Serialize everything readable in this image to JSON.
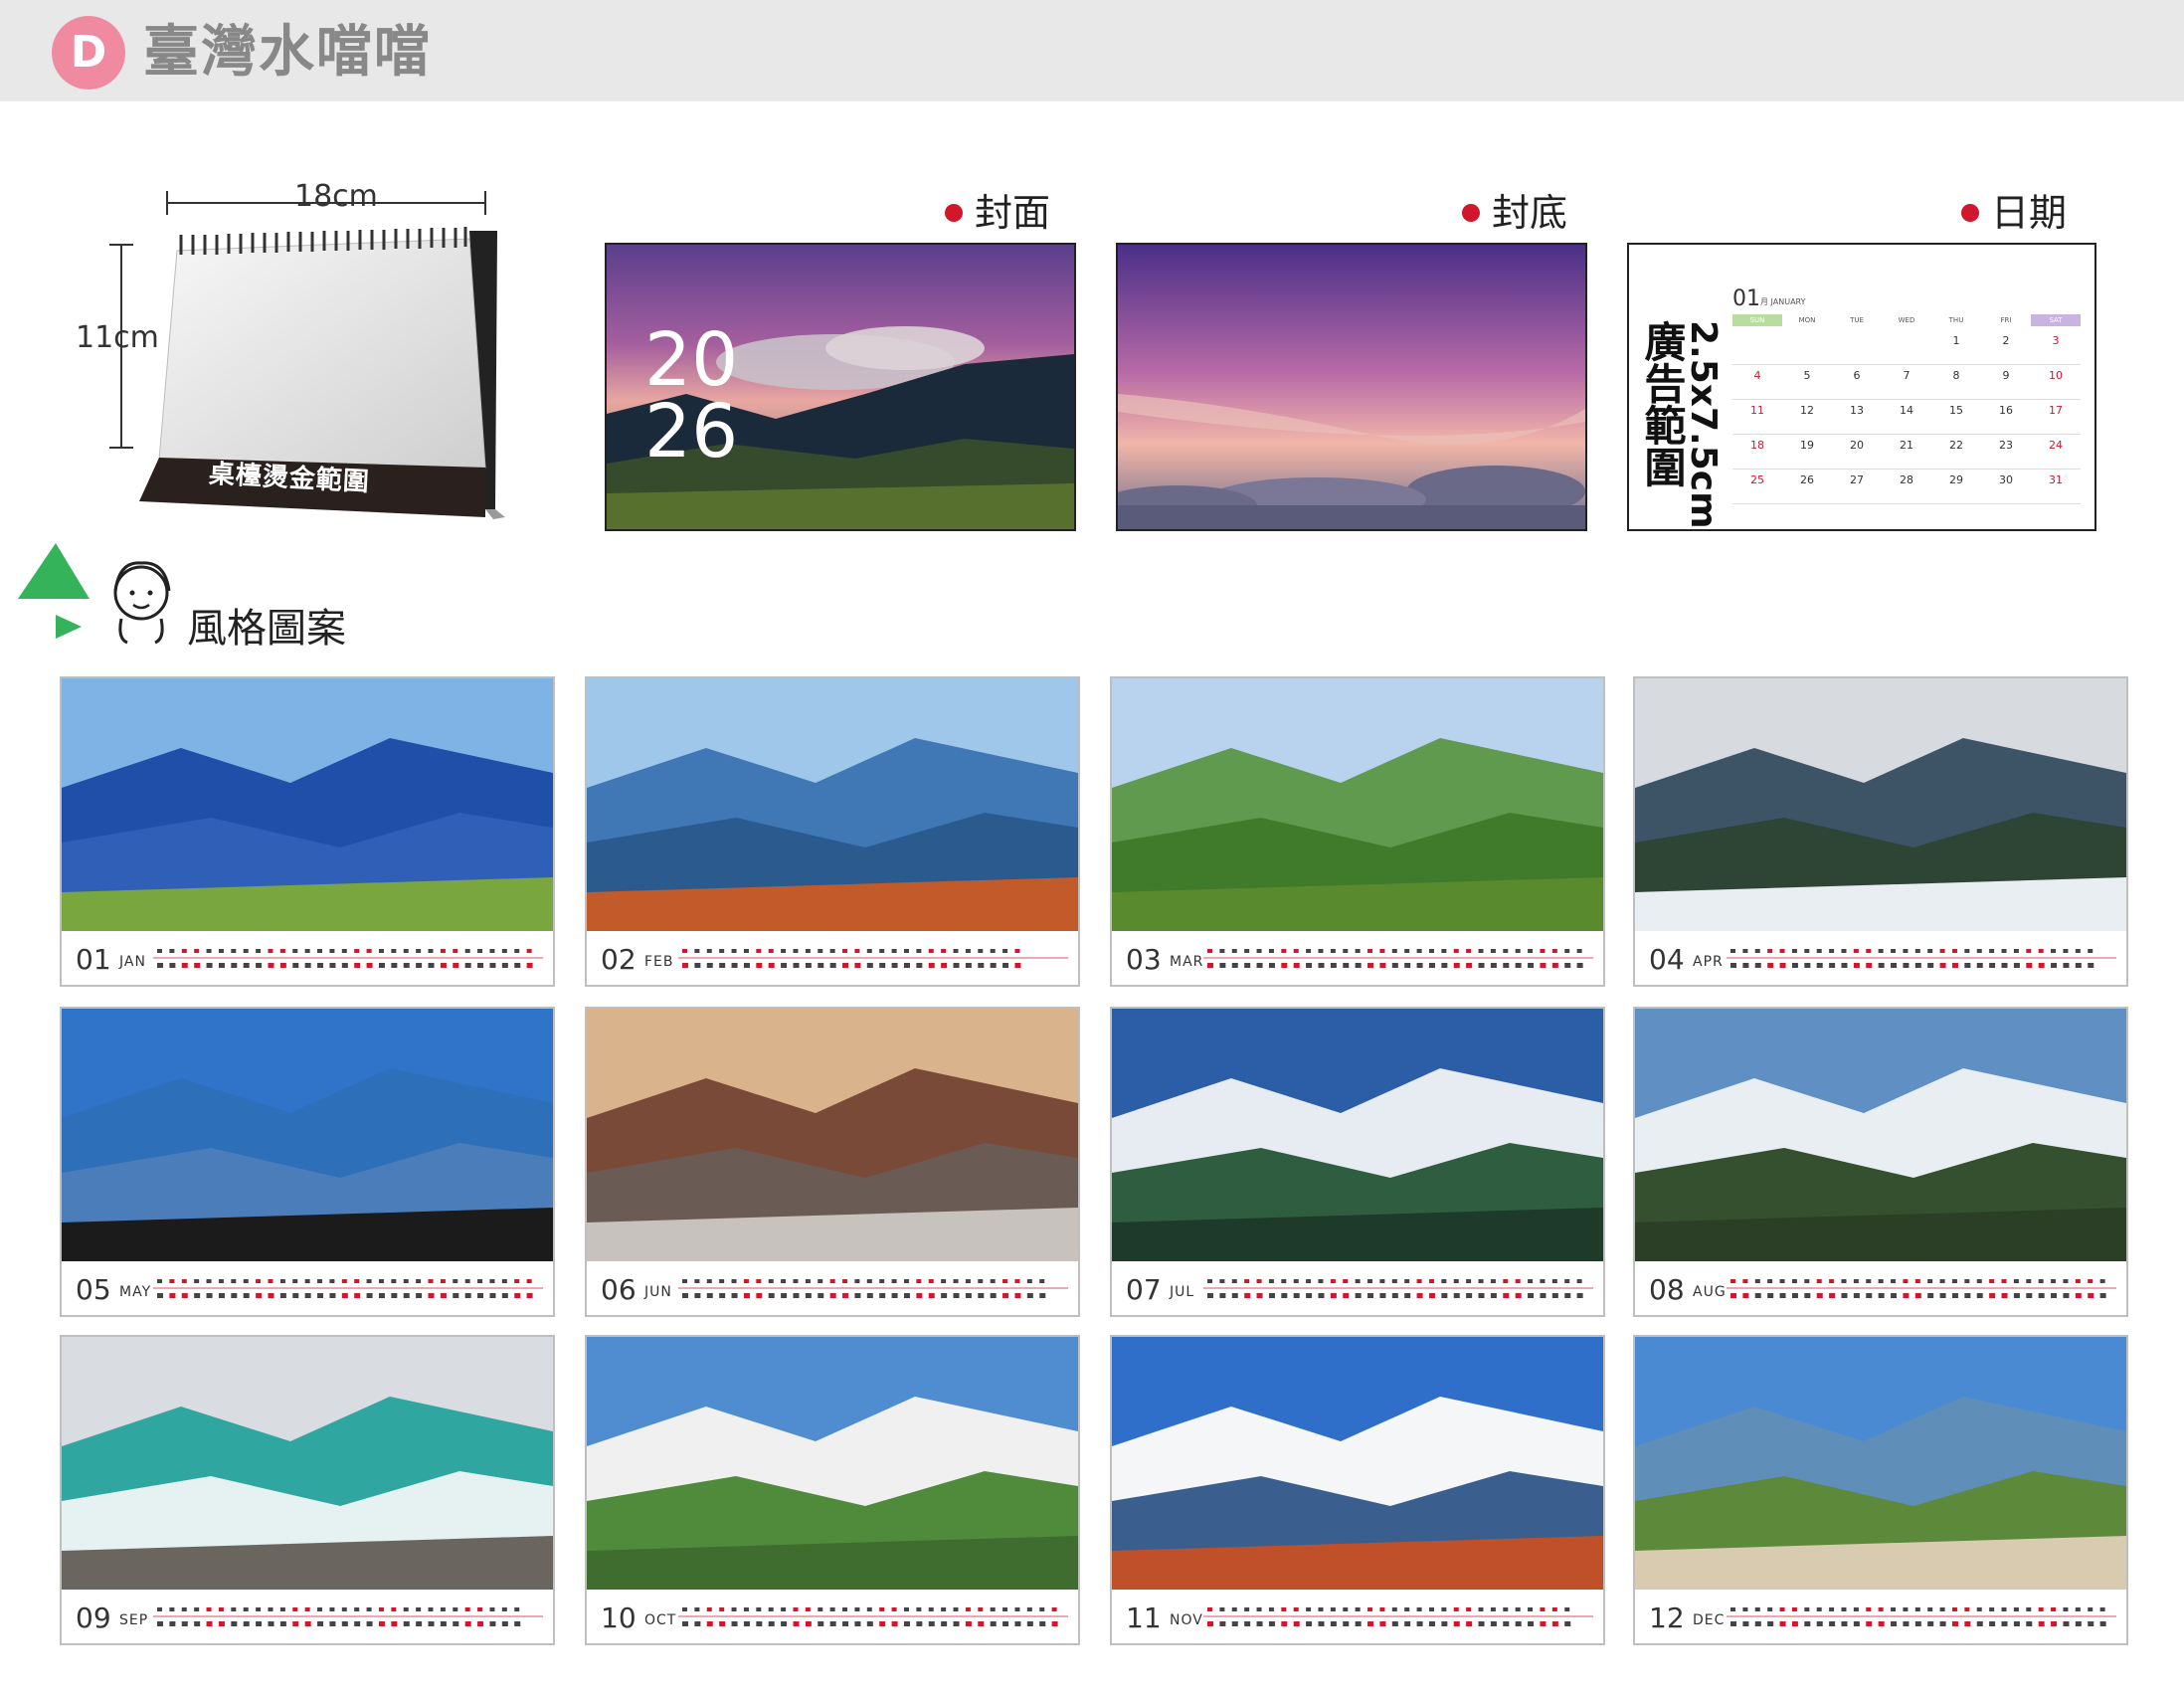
{
  "header": {
    "badge": "D",
    "brand_title": "臺灣水噹噹"
  },
  "desk_calendar": {
    "width_label": "18cm",
    "height_label": "11cm",
    "stamp_area_label": "桌檯燙金範圍"
  },
  "previews": {
    "cover": {
      "label": "封面",
      "year_top": "20",
      "year_bottom": "26"
    },
    "back": {
      "label": "封底"
    },
    "date": {
      "label": "日期",
      "ad_label": "廣告範圍",
      "ad_size": "2.5x7.5cm",
      "month_number": "01",
      "month_name": "月 JANUARY",
      "weekdays": [
        "SUN",
        "MON",
        "TUE",
        "WED",
        "THU",
        "FRI",
        "SAT"
      ],
      "days": [
        "1",
        "2",
        "3",
        "4",
        "5",
        "6",
        "7",
        "8",
        "9",
        "10",
        "11",
        "12",
        "13",
        "14",
        "15",
        "16",
        "17",
        "18",
        "19",
        "20",
        "21",
        "22",
        "23",
        "24",
        "25",
        "26",
        "27",
        "28",
        "29",
        "30",
        "31"
      ]
    }
  },
  "style_section": {
    "heading": "風格圖案"
  },
  "months": [
    {
      "num": "01",
      "name": "JAN"
    },
    {
      "num": "02",
      "name": "FEB"
    },
    {
      "num": "03",
      "name": "MAR"
    },
    {
      "num": "04",
      "name": "APR"
    },
    {
      "num": "05",
      "name": "MAY"
    },
    {
      "num": "06",
      "name": "JUN"
    },
    {
      "num": "07",
      "name": "JUL"
    },
    {
      "num": "08",
      "name": "AUG"
    },
    {
      "num": "09",
      "name": "SEP"
    },
    {
      "num": "10",
      "name": "OCT"
    },
    {
      "num": "11",
      "name": "NOV"
    },
    {
      "num": "12",
      "name": "DEC"
    }
  ],
  "colors": {
    "badge_pink": "#f08aa0",
    "accent_red": "#d0172c",
    "header_gray": "#e8e8e8",
    "sunday_green": "#b9dca0",
    "saturday_purple": "#c9b3e0"
  }
}
